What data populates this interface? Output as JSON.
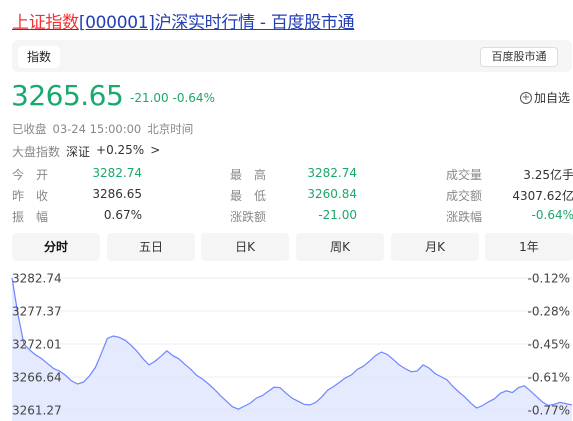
{
  "header": {
    "title_highlight": "上证指数",
    "title_rest": "[000001]沪深实时行情 - 百度股市通"
  },
  "tabs": {
    "active": "指数",
    "source_button": "百度股市通"
  },
  "quote": {
    "price": "3265.65",
    "change": "-21.00",
    "change_pct": "-0.64%",
    "add_watchlist": "加自选",
    "status_label": "已收盘",
    "status_time": "03-24 15:00:00",
    "status_tz": "北京时间",
    "market_label": "大盘指数",
    "market_name": "深证",
    "market_change": "+0.25%",
    "market_arrow": ">"
  },
  "stats": [
    {
      "label": "今　开",
      "value": "3282.74",
      "color": "#1aa86b"
    },
    {
      "label": "最　高",
      "value": "3282.74",
      "color": "#1aa86b"
    },
    {
      "label": "成交量",
      "value": "3.25亿手",
      "color": "#333333"
    },
    {
      "label": "昨　收",
      "value": "3286.65",
      "color": "#333333"
    },
    {
      "label": "最　低",
      "value": "3260.84",
      "color": "#1aa86b"
    },
    {
      "label": "成交额",
      "value": "4307.62亿",
      "color": "#333333"
    },
    {
      "label": "振　幅",
      "value": "0.67%",
      "color": "#333333"
    },
    {
      "label": "涨跌额",
      "value": "-21.00",
      "color": "#1aa86b"
    },
    {
      "label": "涨跌幅",
      "value": "-0.64%",
      "color": "#1aa86b"
    }
  ],
  "period_tabs": [
    "分时",
    "五日",
    "日K",
    "周K",
    "月K",
    "1年"
  ],
  "active_period": "分时",
  "chart_data": {
    "type": "area",
    "y_ticks": [
      "3282.74",
      "3277.37",
      "3272.01",
      "3266.64",
      "3261.27"
    ],
    "pct_ticks": [
      "-0.12%",
      "-0.28%",
      "-0.45%",
      "-0.61%",
      "-0.77%"
    ],
    "ylim": [
      3261.27,
      3282.74
    ],
    "series": [
      {
        "values": [
          3282.74,
          3276.8,
          3272.0,
          3271.0,
          3270.2,
          3269.6,
          3268.8,
          3268.0,
          3267.6,
          3266.9,
          3266.0,
          3265.5,
          3265.8,
          3266.8,
          3268.2,
          3270.5,
          3272.9,
          3273.3,
          3273.1,
          3272.6,
          3271.8,
          3270.8,
          3269.6,
          3268.6,
          3269.2,
          3270.0,
          3270.9,
          3270.1,
          3269.6,
          3268.7,
          3267.9,
          3266.9,
          3266.3,
          3265.5,
          3264.6,
          3263.6,
          3262.7,
          3261.8,
          3261.4,
          3261.9,
          3262.4,
          3263.2,
          3263.6,
          3264.3,
          3265.0,
          3264.9,
          3264.0,
          3263.2,
          3262.7,
          3262.2,
          3262.1,
          3262.5,
          3263.4,
          3264.5,
          3265.1,
          3265.8,
          3266.5,
          3267.0,
          3267.9,
          3268.4,
          3269.2,
          3270.1,
          3270.7,
          3270.3,
          3269.5,
          3268.6,
          3268.0,
          3267.5,
          3267.6,
          3268.6,
          3268.1,
          3267.2,
          3266.7,
          3266.2,
          3265.1,
          3264.2,
          3263.4,
          3262.4,
          3261.6,
          3262.0,
          3262.6,
          3263.1,
          3264.0,
          3264.4,
          3264.1,
          3264.9,
          3265.2,
          3264.4,
          3263.5,
          3262.6,
          3262.0,
          3262.2,
          3262.5,
          3262.3,
          3262.1
        ]
      }
    ],
    "baseline": 3286.65,
    "grid": true
  },
  "colors": {
    "up_down_green": "#1aa86b",
    "title_red": "#f73131",
    "link_blue": "#2440b3",
    "line": "#6f86ff",
    "fill": "#dde3ff"
  }
}
